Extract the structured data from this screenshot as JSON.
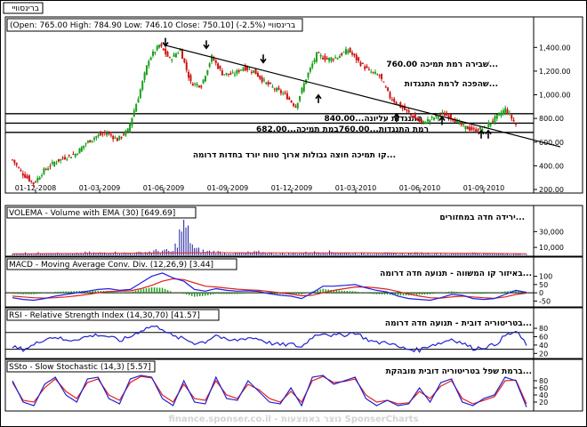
{
  "header": {
    "top_tab": "ברינסוויי",
    "summary": "(Open: 765.00  High: 784.90  Low: 746.10  Close: 750.10] (-2.5%) ברינסוויי"
  },
  "annotations": {
    "a1": "שׁבירה רמת תמיכה 760.00...",
    "a2": "שהפכה לרמת התנגדות...",
    "a3": "התנגדות עליונה...840.00",
    "a4": "רמת התנגדות...760.00במת תמיכה...682.00",
    "a5": "קו תמיכה חוצה גבולות ארוך טווח יורד בחדות דרומה...",
    "vol": "ירידה חדה במחזורים...",
    "macd": "באיזור קו המשווה - תנועה חדה דרומה...",
    "rsi": "בטריטוריה דובית - תנועה חדה דרומה...",
    "ssto": "ברמת שפל בטריטוריה דובית מובהקת..."
  },
  "watermark": "finance.sponser.co.il - נוצר באמצעות SponserCharts",
  "colors": {
    "up": "#1aa01a",
    "down": "#d01010",
    "volume": "#1a1aa0",
    "macd": "#2020e0",
    "signal": "#e02020",
    "hist": "#1aa01a",
    "osc": "#2020d0"
  },
  "chart_data": [
    {
      "type": "line",
      "name": "price",
      "x_labels": [
        "01-12-2008",
        "01-03-2009",
        "01-06-2009",
        "01-09-2009",
        "01-12-2009",
        "01-03-2010",
        "01-06-2010",
        "01-09-2010"
      ],
      "y_ticks": [
        "1,400.00",
        "1,200.00",
        "1,000.00",
        "800.00",
        "600.00",
        "400.00",
        "200.00"
      ],
      "ylim": [
        200,
        1500
      ],
      "close": [
        450,
        330,
        250,
        360,
        430,
        470,
        500,
        590,
        650,
        680,
        620,
        700,
        980,
        1300,
        1420,
        1300,
        1380,
        1100,
        1080,
        1320,
        1180,
        1170,
        1230,
        1200,
        1110,
        1050,
        1000,
        900,
        1140,
        1340,
        1300,
        1320,
        1380,
        1280,
        1200,
        1160,
        980,
        900,
        830,
        760,
        800,
        840,
        800,
        730,
        700,
        720,
        800,
        880,
        750
      ]
    },
    {
      "type": "bar",
      "name": "volume",
      "title": "VOLEMA - Volume with EMA (30) [649.69]",
      "y_ticks": [
        "30,000",
        "10,000"
      ],
      "ylim": [
        0,
        45000
      ],
      "values": [
        1500,
        3000,
        2000,
        4000,
        2500,
        1800,
        2200,
        3500,
        2800,
        4000,
        3000,
        2500,
        3500,
        5000,
        6000,
        4500,
        40000,
        8000,
        5000,
        4500,
        3000,
        2500,
        3500,
        4000,
        3000,
        2000,
        2500,
        3000,
        3500,
        4500,
        4000,
        3000,
        2500,
        2000,
        3000,
        2500,
        1800,
        2200,
        3000,
        2500,
        2000,
        1800,
        2500,
        3000,
        2200,
        1800,
        2000,
        1500,
        800
      ],
      "ema": [
        2000,
        2000,
        2050,
        2100,
        2200,
        2250,
        2300,
        2400,
        2500,
        2600,
        2700,
        2750,
        2800,
        2900,
        3000,
        3100,
        3200,
        3300,
        3400,
        3400,
        3300,
        3250,
        3200,
        3150,
        3100,
        3050,
        3000,
        3000,
        3000,
        3050,
        3100,
        3100,
        3050,
        3000,
        2950,
        2900,
        2850,
        2800,
        2750,
        2700,
        2650,
        2600,
        2550,
        2500,
        2450,
        2400,
        2300,
        2100,
        1900
      ]
    },
    {
      "type": "line",
      "name": "macd",
      "title": "MACD - Moving Average Conv. Div. (12,26,9) [3.44]",
      "y_ticks": [
        "100",
        "50",
        "0",
        "-50"
      ],
      "ylim": [
        -80,
        130
      ],
      "macd": [
        -30,
        -40,
        -45,
        -35,
        -20,
        -10,
        0,
        10,
        20,
        25,
        15,
        20,
        60,
        100,
        120,
        90,
        70,
        20,
        10,
        25,
        15,
        10,
        12,
        8,
        -5,
        -15,
        -20,
        -35,
        0,
        40,
        40,
        45,
        50,
        30,
        15,
        5,
        -20,
        -35,
        -40,
        -45,
        -30,
        -10,
        -15,
        -35,
        -40,
        -35,
        -10,
        15,
        3
      ],
      "signal": [
        -20,
        -25,
        -30,
        -32,
        -30,
        -25,
        -18,
        -10,
        0,
        8,
        10,
        12,
        25,
        45,
        70,
        85,
        80,
        60,
        40,
        35,
        28,
        22,
        18,
        15,
        8,
        0,
        -8,
        -18,
        -15,
        0,
        15,
        25,
        35,
        35,
        30,
        22,
        8,
        -8,
        -20,
        -30,
        -32,
        -25,
        -20,
        -25,
        -30,
        -33,
        -25,
        -10,
        -2
      ]
    },
    {
      "type": "line",
      "name": "rsi",
      "title": "RSI - Relative Strength Index (14,30,70) [41.57]",
      "y_ticks": [
        "80",
        "60",
        "40",
        "20"
      ],
      "ylim": [
        10,
        95
      ],
      "values": [
        35,
        30,
        40,
        55,
        60,
        50,
        55,
        60,
        65,
        60,
        50,
        60,
        75,
        85,
        80,
        60,
        55,
        45,
        48,
        65,
        50,
        52,
        58,
        55,
        45,
        40,
        42,
        35,
        60,
        70,
        62,
        65,
        70,
        55,
        45,
        48,
        35,
        30,
        28,
        40,
        45,
        55,
        45,
        32,
        35,
        40,
        62,
        72,
        42
      ]
    },
    {
      "type": "line",
      "name": "ssto",
      "title": "SSto - Slow Stochastic (14,3) [5.57]",
      "y_ticks": [
        "80",
        "60",
        "40",
        "20"
      ],
      "ylim": [
        0,
        100
      ],
      "k": [
        80,
        20,
        10,
        70,
        90,
        40,
        20,
        85,
        90,
        30,
        15,
        85,
        95,
        90,
        30,
        10,
        80,
        20,
        15,
        90,
        30,
        25,
        80,
        50,
        20,
        15,
        60,
        10,
        90,
        95,
        70,
        80,
        90,
        30,
        10,
        25,
        10,
        15,
        60,
        20,
        75,
        85,
        20,
        10,
        30,
        40,
        90,
        80,
        6
      ],
      "d": [
        75,
        25,
        20,
        60,
        85,
        50,
        30,
        75,
        85,
        40,
        25,
        75,
        92,
        88,
        40,
        20,
        70,
        30,
        25,
        80,
        40,
        30,
        70,
        55,
        30,
        20,
        50,
        20,
        80,
        92,
        75,
        78,
        85,
        40,
        20,
        25,
        15,
        18,
        50,
        30,
        65,
        80,
        30,
        15,
        25,
        35,
        80,
        82,
        15
      ]
    }
  ]
}
